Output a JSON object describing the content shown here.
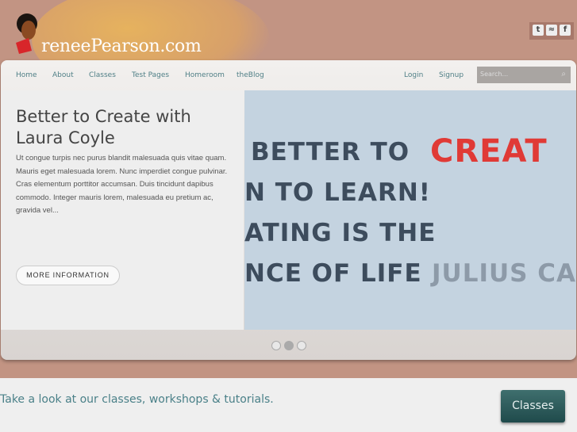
{
  "site": {
    "logo": "reneePearson.com"
  },
  "social": [
    {
      "icon": "twitter-icon",
      "glyph": "t"
    },
    {
      "icon": "rss-icon",
      "glyph": "≈"
    },
    {
      "icon": "facebook-icon",
      "glyph": "f"
    }
  ],
  "nav": {
    "items": [
      "Home",
      "About",
      "Classes",
      "Test Pages",
      "Homeroom",
      "theBlog"
    ],
    "login": "Login",
    "signup": "Signup",
    "search_placeholder": "Search..."
  },
  "slide": {
    "title": "Better to Create with Laura Coyle",
    "body": "Ut congue turpis nec purus blandit malesuada quis vitae quam. Mauris eget malesuada lorem. Nunc imperdiet congue pulvinar. Cras elementum porttitor accumsan. Duis tincidunt dapibus commodo. Integer mauris lorem, malesuada eu pretium ac, gravida vel...",
    "button": "MORE INFORMATION",
    "image_lines": [
      "BETTER TO",
      "CREAT",
      "N TO LEARN!",
      "ATING IS THE",
      "NCE OF LIFE",
      "JULIUS CA"
    ],
    "active_dot": 2,
    "dot_count": 3
  },
  "footer": {
    "tagline": "Take a look at our classes, workshops & tutorials.",
    "button": "Classes"
  }
}
